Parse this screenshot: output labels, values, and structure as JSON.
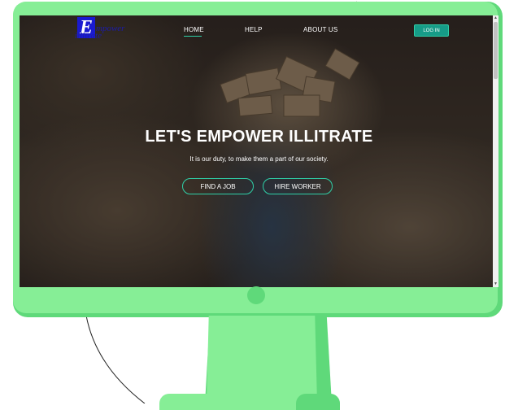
{
  "nav": {
    "logo_line1": "mpower",
    "logo_line2": "illitrate",
    "logo_letter": "E",
    "items": [
      {
        "label": "HOME",
        "active": true
      },
      {
        "label": "HELP",
        "active": false
      },
      {
        "label": "ABOUT US",
        "active": false
      }
    ],
    "login_label": "LOG IN"
  },
  "hero": {
    "title": "LET'S EMPOWER ILLITRATE",
    "subtitle": "It is our duty, to make them a part of our society.",
    "primary_cta": "FIND A JOB",
    "secondary_cta": "HIRE WORKER"
  },
  "colors": {
    "accent": "#2fd0a8",
    "login_bg": "#169c88",
    "monitor": "#86ee96",
    "monitor_shadow": "#5fd97a",
    "logo": "#1a1ad0"
  },
  "icons": {
    "scroll_up": "▲",
    "scroll_down": "▼"
  }
}
